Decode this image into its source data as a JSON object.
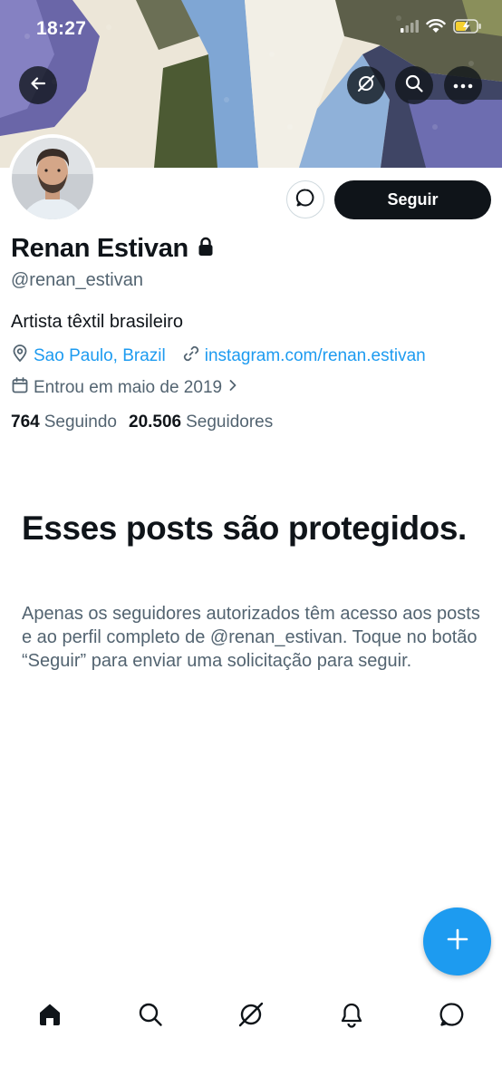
{
  "status_bar": {
    "time": "18:27"
  },
  "top_bar": {
    "back_icon": "arrow-left-icon",
    "grok_icon": "grok-icon",
    "search_icon": "search-icon",
    "more_icon": "more-horizontal-icon"
  },
  "profile": {
    "display_name": "Renan Estivan",
    "handle": "@renan_estivan",
    "bio": "Artista têxtil brasileiro",
    "location": "Sao Paulo, Brazil",
    "website": "instagram.com/renan.estivan",
    "joined": "Entrou em maio de 2019",
    "following_count": "764",
    "following_label": "Seguindo",
    "followers_count": "20.506",
    "followers_label": "Seguidores",
    "follow_button": "Seguir"
  },
  "protected": {
    "title": "Esses posts são protegidos.",
    "body": "Apenas os seguidores autorizados têm acesso aos posts e ao perfil completo de @renan_estivan. Toque no botão “Seguir” para enviar uma solicitação para seguir."
  },
  "bottom_nav": {
    "items": [
      "home-icon",
      "search-icon",
      "grok-icon",
      "notifications-icon",
      "messages-icon"
    ]
  },
  "colors": {
    "accent": "#1d9bf0",
    "text_primary": "#0f1419",
    "text_secondary": "#536471",
    "follow_button_bg": "#0f1419"
  }
}
